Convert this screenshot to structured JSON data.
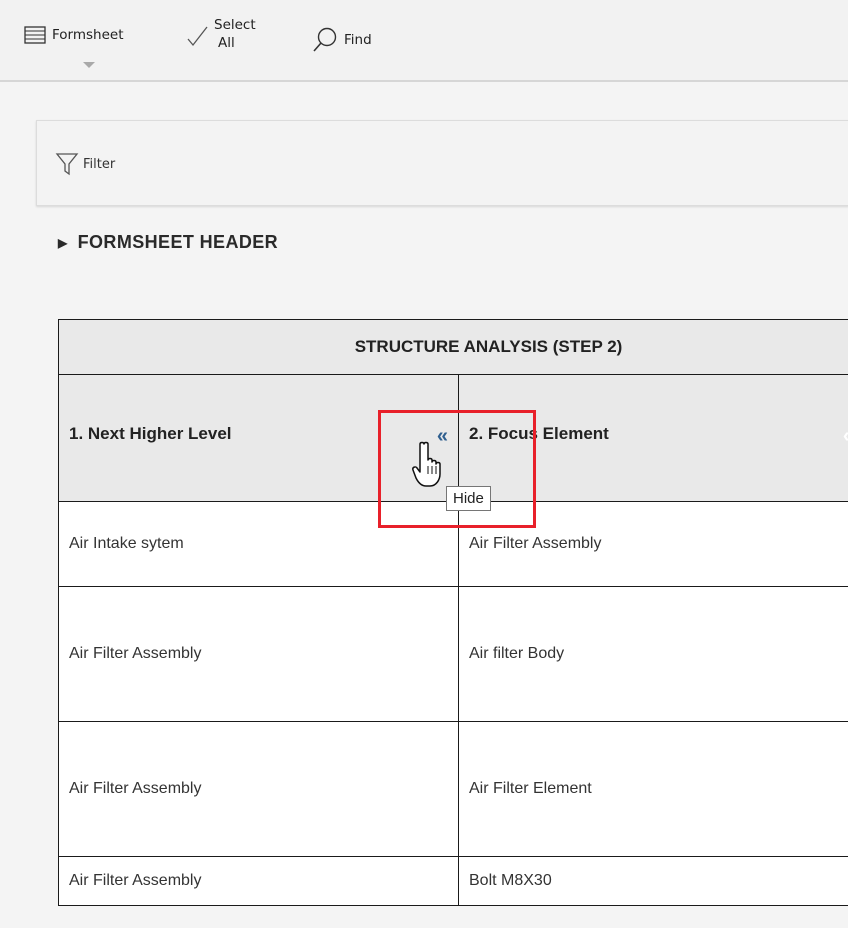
{
  "toolbar": {
    "formsheet_label": "Formsheet",
    "select_all_line1": "Select",
    "select_all_line2": "All",
    "find_label": "Find"
  },
  "filter": {
    "label": "Filter"
  },
  "section": {
    "toggle_label": "FORMSHEET HEADER"
  },
  "table": {
    "group_header": "STRUCTURE ANALYSIS (STEP 2)",
    "columns": [
      "1. Next Higher Level",
      "2. Focus Element"
    ],
    "rows": [
      [
        "Air Intake sytem",
        "Air Filter Assembly"
      ],
      [
        "Air Filter Assembly",
        "Air filter Body"
      ],
      [
        "Air Filter Assembly",
        "Air Filter Element"
      ],
      [
        "Air Filter Assembly",
        "Bolt M8X30"
      ]
    ]
  },
  "tooltip": {
    "text": "Hide"
  },
  "colors": {
    "highlight": "#e8202a",
    "collapse_icon": "#2f5f8f",
    "header_bg": "#e9e9e9"
  },
  "icons": [
    "formsheet-icon",
    "checkmark-icon",
    "search-icon",
    "filter-icon",
    "collapse-double-chevron-icon",
    "hand-cursor-icon"
  ]
}
